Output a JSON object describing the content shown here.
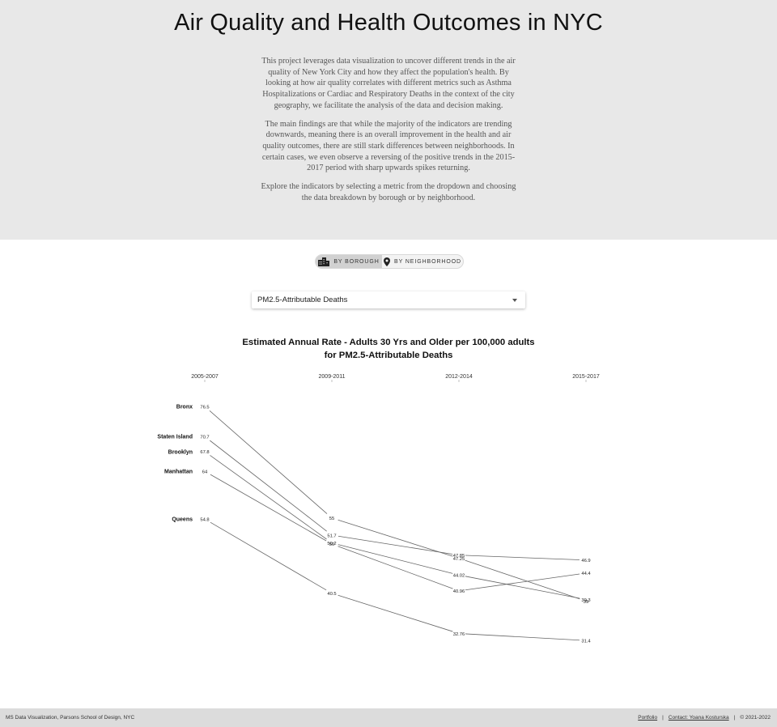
{
  "header": {
    "title": "Air Quality and Health Outcomes in NYC",
    "paragraphs": [
      "This project leverages data visualization to uncover different trends in the air quality of New York City and how they affect the population's health. By looking at how air quality correlates with different metrics such as Asthma Hospitalizations or Cardiac and Respiratory Deaths in the context of the city geography, we facilitate the analysis of the data and decision making.",
      "The main findings are that while the majority of the indicators are trending downwards, meaning there is an overall improvement in the health and air quality outcomes, there are still stark differences between neighborhoods. In certain cases, we even observe a reversing of the positive trends in the 2015-2017 period with sharp upwards spikes returning.",
      "Explore the indicators by selecting a metric from the dropdown and choosing the data breakdown by borough or by neighborhood."
    ]
  },
  "toggle": {
    "borough_label": "BY BOROUGH",
    "neighborhood_label": "BY NEIGHBORHOOD",
    "active": "borough"
  },
  "metric_select": {
    "value": "PM2.5-Attributable Deaths"
  },
  "chart": {
    "title_line1": "Estimated Annual Rate - Adults 30 Yrs and Older per 100,000 adults",
    "title_line2": "for PM2.5-Attributable Deaths"
  },
  "chart_data": {
    "type": "line",
    "title": "Estimated Annual Rate - Adults 30 Yrs and Older per 100,000 adults for PM2.5-Attributable Deaths",
    "categories": [
      "2005-2007",
      "2009-2011",
      "2012-2014",
      "2015-2017"
    ],
    "ylim": [
      28,
      79
    ],
    "series": [
      {
        "name": "Bronx",
        "values": [
          76.5,
          55,
          47.25,
          39
        ]
      },
      {
        "name": "Staten Island",
        "values": [
          70.7,
          51.7,
          47.85,
          46.9
        ]
      },
      {
        "name": "Brooklyn",
        "values": [
          67.8,
          50.2,
          44.02,
          39.3
        ]
      },
      {
        "name": "Manhattan",
        "values": [
          64,
          50,
          40.96,
          44.4
        ]
      },
      {
        "name": "Queens",
        "values": [
          54.8,
          40.5,
          32.76,
          31.4
        ]
      }
    ],
    "line_color": "#666666",
    "grid": false,
    "legend": "none"
  },
  "footer": {
    "left_text": "MS Data Visualization, Parsons School of Design, NYC",
    "portfolio_link": "Portfolio",
    "separator": "|",
    "contact_link": "Contact: Yoana Kosturska",
    "copyright": "© 2021-2022"
  }
}
